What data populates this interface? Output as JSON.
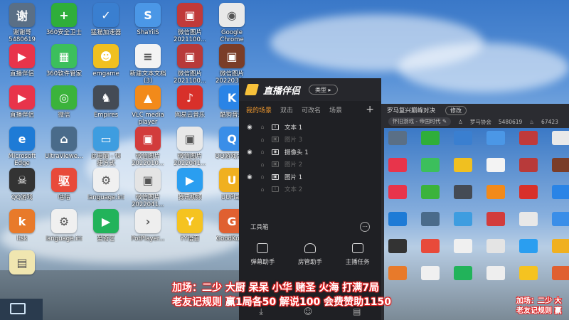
{
  "desktop": {
    "icons": [
      {
        "label": "谢谢哥\n5480619",
        "color": "#5a6f86",
        "glyph": "谢"
      },
      {
        "label": "360安全卫士",
        "color": "#2fae3a",
        "glyph": "+"
      },
      {
        "label": "猛猫加速器",
        "color": "#3a7fd0",
        "glyph": "✓"
      },
      {
        "label": "ShaYiIS",
        "color": "#4b97e6",
        "glyph": "S"
      },
      {
        "label": "微信图片\n2021100...",
        "color": "#c03a3a",
        "glyph": "▣"
      },
      {
        "label": "Google\nChrome",
        "color": "#e9e9e9",
        "glyph": "◉"
      },
      {
        "label": "直播伴侣",
        "color": "#e8344b",
        "glyph": "▶"
      },
      {
        "label": "360软件管家",
        "color": "#3cbf5c",
        "glyph": "▦"
      },
      {
        "label": "emgame",
        "color": "#f0c020",
        "glyph": "☻"
      },
      {
        "label": "新建文本文档\n(3)",
        "color": "#f3f3f3",
        "glyph": "≡"
      },
      {
        "label": "微信图片\n2021100...",
        "color": "#b83a3a",
        "glyph": "▣"
      },
      {
        "label": "微信图片\n2022032...",
        "color": "#7a3d28",
        "glyph": "▣"
      },
      {
        "label": "直播伴侣",
        "color": "#e8344b",
        "glyph": "▶"
      },
      {
        "label": "微信",
        "color": "#3bb33b",
        "glyph": "◎"
      },
      {
        "label": "Empires",
        "color": "#444b55",
        "glyph": "♞"
      },
      {
        "label": "VLC media\nplayer",
        "color": "#f28a1a",
        "glyph": "▲"
      },
      {
        "label": "网易云音乐",
        "color": "#d8302a",
        "glyph": "♪"
      },
      {
        "label": "酷狗音乐",
        "color": "#2a84e6",
        "glyph": "K"
      },
      {
        "label": "Microsoft\nEdge",
        "color": "#1e7bd6",
        "glyph": "e"
      },
      {
        "label": "UltraViewe...",
        "color": "#4a6b8a",
        "glyph": "⌂"
      },
      {
        "label": "此电脑 - 快\n捷方式",
        "color": "#3e9de0",
        "glyph": "▭"
      },
      {
        "label": "微信图片\n2022010...",
        "color": "#d23c3c",
        "glyph": "▣"
      },
      {
        "label": "微信图片\n2022041...",
        "color": "#e8e8e8",
        "glyph": "▣"
      },
      {
        "label": "QQ游戏大厅",
        "color": "#3a8ee8",
        "glyph": "Q"
      },
      {
        "label": "QQ游戏",
        "color": "#333333",
        "glyph": "☠"
      },
      {
        "label": "咕咕",
        "color": "#e84a3a",
        "glyph": "驱"
      },
      {
        "label": "language.ini",
        "color": "#f0f0f0",
        "glyph": "⚙"
      },
      {
        "label": "微信图片\n2022041...",
        "color": "#e4e4e4",
        "glyph": "▣"
      },
      {
        "label": "腾讯视频",
        "color": "#2a9ef0",
        "glyph": "▶"
      },
      {
        "label": "UUPlay",
        "color": "#f0b020",
        "glyph": "U"
      },
      {
        "label": "ltsk",
        "color": "#e87a2a",
        "glyph": "k"
      },
      {
        "label": "language.ini",
        "color": "#f0f0f0",
        "glyph": "⚙"
      },
      {
        "label": "爱奇艺",
        "color": "#22b35a",
        "glyph": "▶"
      },
      {
        "label": "PotPlayer...",
        "color": "#eeeeee",
        "glyph": "›"
      },
      {
        "label": "YY语音",
        "color": "#f5c320",
        "glyph": "Y"
      },
      {
        "label": "GoodKuy...",
        "color": "#e06030",
        "glyph": "G"
      },
      {
        "label": "",
        "color": "#f0e6b0",
        "glyph": "▤"
      }
    ]
  },
  "app": {
    "title": "直播伴侣",
    "type_button": "类型",
    "tabs": [
      "我的场景",
      "双击",
      "可改名",
      "场景"
    ],
    "add_icon": "plus-icon",
    "scenes": [
      {
        "label": "文本 1",
        "visible": true,
        "kind": "T"
      },
      {
        "label": "图片 3",
        "visible": false,
        "kind": "▣"
      },
      {
        "label": "摄像头 1",
        "visible": true,
        "kind": "◉"
      },
      {
        "label": "图片 2",
        "visible": false,
        "kind": "▣"
      },
      {
        "label": "图片 1",
        "visible": true,
        "kind": "▣"
      },
      {
        "label": "文本 2",
        "visible": false,
        "kind": "T"
      }
    ],
    "toolbox_label": "工具箱",
    "tools": [
      {
        "label": "弹幕助手",
        "icon": "danmaku-icon"
      },
      {
        "label": "房管助手",
        "icon": "admin-icon"
      },
      {
        "label": "主播任务",
        "icon": "task-icon"
      }
    ]
  },
  "preview": {
    "title": "罗马复兴巅峰对决",
    "edit_label": "修改",
    "category": "怀旧游戏 - 帝国时代",
    "host_label": "罗马协会",
    "room_id": "5480619",
    "viewer_count": "67423"
  },
  "overlay": {
    "line1": "加场：二少 大厨 呆呆 小华 赌圣 火海 打满7局",
    "line2": "老友记规则 赢1局各50 解说100 会费赞助1150",
    "mini1": "加场：二少 大",
    "mini2": "老友记规则 赢"
  },
  "colors": {
    "accent": "#f39a2e",
    "overlay_stroke": "#e02020",
    "panel_bg": "#1f2024"
  }
}
